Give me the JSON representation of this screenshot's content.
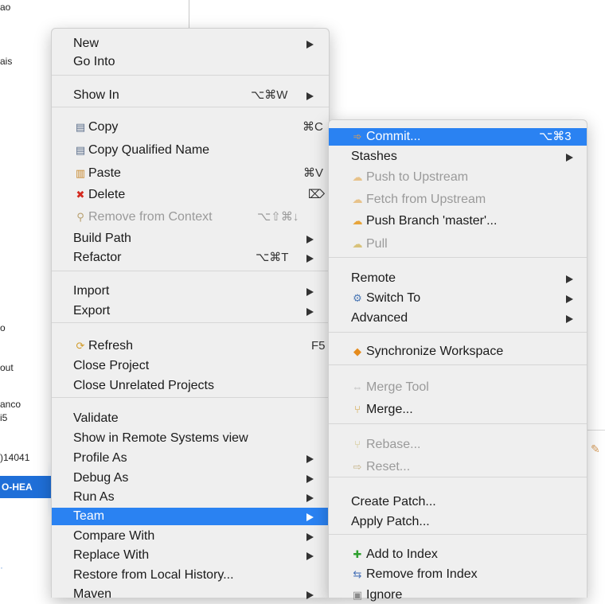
{
  "background": {
    "texts": [
      "ao",
      "ais",
      "o",
      "out",
      "anco",
      "i5",
      ")14041",
      "·"
    ],
    "selected_text": "O-HEA"
  },
  "main_menu": [
    {
      "type": "item",
      "label": "New",
      "submenu": true
    },
    {
      "type": "item",
      "label": "Go Into"
    },
    {
      "type": "sep"
    },
    {
      "type": "item",
      "label": "Show In",
      "shortcut": "⌥⌘W",
      "submenu": true
    },
    {
      "type": "sep"
    },
    {
      "type": "item",
      "label": "Copy",
      "icon": "copy-icon",
      "glyph": "▤",
      "shortcut": "⌘C"
    },
    {
      "type": "item",
      "label": "Copy Qualified Name",
      "icon": "copy-qualified-icon",
      "glyph": "▤"
    },
    {
      "type": "item",
      "label": "Paste",
      "icon": "paste-icon",
      "glyph": "▥",
      "shortcut": "⌘V"
    },
    {
      "type": "item",
      "label": "Delete",
      "icon": "delete-icon",
      "glyph": "✖",
      "shortcut": "⌦"
    },
    {
      "type": "item",
      "label": "Remove from Context",
      "icon": "remove-context-icon",
      "glyph": "⚲",
      "shortcut": "⌥⇧⌘↓",
      "disabled": true
    },
    {
      "type": "item",
      "label": "Build Path",
      "submenu": true
    },
    {
      "type": "item",
      "label": "Refactor",
      "shortcut": "⌥⌘T",
      "submenu": true
    },
    {
      "type": "sep"
    },
    {
      "type": "item",
      "label": "Import",
      "submenu": true
    },
    {
      "type": "item",
      "label": "Export",
      "submenu": true
    },
    {
      "type": "sep"
    },
    {
      "type": "item",
      "label": "Refresh",
      "icon": "refresh-icon",
      "glyph": "⟳",
      "shortcut": "F5"
    },
    {
      "type": "item",
      "label": "Close Project"
    },
    {
      "type": "item",
      "label": "Close Unrelated Projects"
    },
    {
      "type": "sep"
    },
    {
      "type": "item",
      "label": "Validate"
    },
    {
      "type": "item",
      "label": "Show in Remote Systems view"
    },
    {
      "type": "item",
      "label": "Profile As",
      "submenu": true
    },
    {
      "type": "item",
      "label": "Debug As",
      "submenu": true
    },
    {
      "type": "item",
      "label": "Run As",
      "submenu": true
    },
    {
      "type": "item",
      "label": "Team",
      "submenu": true,
      "selected": true
    },
    {
      "type": "item",
      "label": "Compare With",
      "submenu": true
    },
    {
      "type": "item",
      "label": "Replace With",
      "submenu": true
    },
    {
      "type": "item",
      "label": "Restore from Local History..."
    },
    {
      "type": "item",
      "label": "Maven",
      "submenu": true
    }
  ],
  "team_menu": [
    {
      "type": "item",
      "label": "Commit...",
      "icon": "commit-icon",
      "glyph": "➾",
      "shortcut": "⌥⌘3",
      "selected": true
    },
    {
      "type": "item",
      "label": "Stashes",
      "submenu": true
    },
    {
      "type": "item",
      "label": "Push to Upstream",
      "icon": "push-upstream-icon",
      "glyph": "☁",
      "disabled": true
    },
    {
      "type": "item",
      "label": "Fetch from Upstream",
      "icon": "fetch-upstream-icon",
      "glyph": "☁",
      "disabled": true
    },
    {
      "type": "item",
      "label": "Push Branch 'master'...",
      "icon": "push-branch-icon",
      "glyph": "☁"
    },
    {
      "type": "item",
      "label": "Pull",
      "icon": "pull-icon",
      "glyph": "☁",
      "disabled": true
    },
    {
      "type": "sep"
    },
    {
      "type": "item",
      "label": "Remote",
      "submenu": true
    },
    {
      "type": "item",
      "label": "Switch To",
      "icon": "switch-to-icon",
      "glyph": "⚙",
      "submenu": true
    },
    {
      "type": "item",
      "label": "Advanced",
      "submenu": true
    },
    {
      "type": "sep"
    },
    {
      "type": "item",
      "label": "Synchronize Workspace",
      "icon": "synchronize-icon",
      "glyph": "◆"
    },
    {
      "type": "sep"
    },
    {
      "type": "item",
      "label": "Merge Tool",
      "icon": "merge-tool-icon",
      "glyph": "⇔",
      "disabled": true
    },
    {
      "type": "item",
      "label": "Merge...",
      "icon": "merge-icon",
      "glyph": "⑂"
    },
    {
      "type": "sep"
    },
    {
      "type": "item",
      "label": "Rebase...",
      "icon": "rebase-icon",
      "glyph": "⑂",
      "disabled": true
    },
    {
      "type": "item",
      "label": "Reset...",
      "icon": "reset-icon",
      "glyph": "⇨",
      "disabled": true
    },
    {
      "type": "sep"
    },
    {
      "type": "item",
      "label": "Create Patch..."
    },
    {
      "type": "item",
      "label": "Apply Patch..."
    },
    {
      "type": "sep"
    },
    {
      "type": "item",
      "label": "Add to Index",
      "icon": "add-to-index-icon",
      "glyph": "✚"
    },
    {
      "type": "item",
      "label": "Remove from Index",
      "icon": "remove-from-index-icon",
      "glyph": "⇆"
    },
    {
      "type": "item",
      "label": "Ignore",
      "icon": "ignore-icon",
      "glyph": "▣"
    }
  ]
}
